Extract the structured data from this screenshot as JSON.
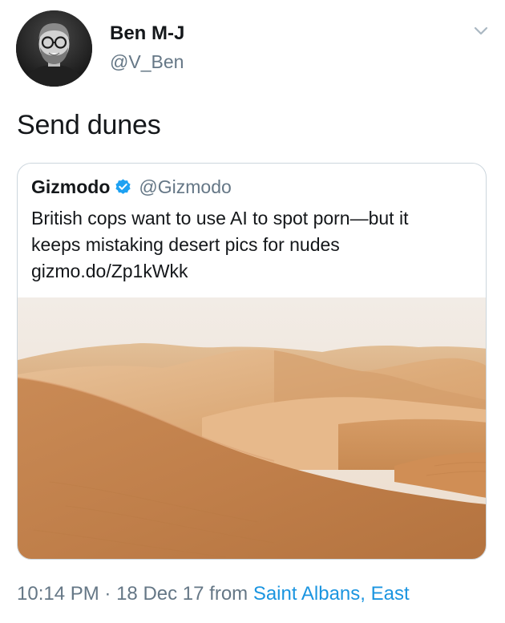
{
  "tweet": {
    "author": {
      "name": "Ben M-J",
      "handle": "@V_Ben"
    },
    "text": "Send dunes",
    "quoted_tweet": {
      "author_name": "Gizmodo",
      "author_handle": "@Gizmodo",
      "verified": true,
      "text_lines": [
        "British cops want to use AI to spot porn—but it",
        "keeps mistaking desert pics for nudes",
        "gizmo.do/Zp1kWkk"
      ]
    },
    "meta": {
      "time": "10:14 PM",
      "separator": "·",
      "date": "18 Dec 17",
      "from_label": "from",
      "location": "Saint Albans, East"
    }
  },
  "icons": {
    "menu": "chevron-down-icon",
    "verified": "verified-badge-icon"
  },
  "colors": {
    "text_primary": "#14171a",
    "text_secondary": "#657786",
    "link": "#1b95e0",
    "verified": "#1da1f2",
    "border": "#ccd6dd"
  }
}
